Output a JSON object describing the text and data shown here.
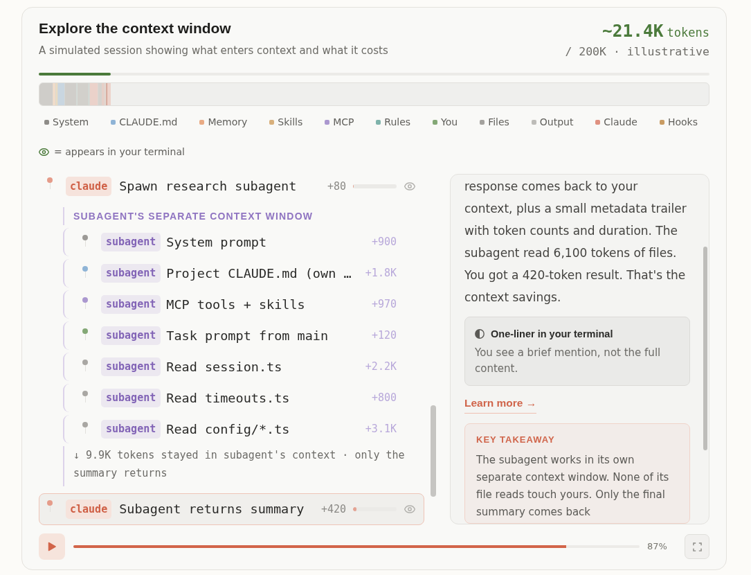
{
  "header": {
    "title": "Explore the context window",
    "subtitle": "A simulated session showing what enters context and what it costs",
    "token_total": "~21.4K",
    "token_unit": "tokens",
    "token_limit": "/ 200K · illustrative"
  },
  "context_meter": {
    "level": 0.107
  },
  "legend": [
    {
      "label": "System",
      "color": "#8e8c88"
    },
    {
      "label": "CLAUDE.md",
      "color": "#8fb4d6"
    },
    {
      "label": "Memory",
      "color": "#e9ab84"
    },
    {
      "label": "Skills",
      "color": "#d8b07c"
    },
    {
      "label": "MCP",
      "color": "#ab98cf"
    },
    {
      "label": "Rules",
      "color": "#7fb3ab"
    },
    {
      "label": "You",
      "color": "#84a876"
    },
    {
      "label": "Files",
      "color": "#a4a29e"
    },
    {
      "label": "Output",
      "color": "#bdbcb8"
    },
    {
      "label": "Claude",
      "color": "#df9180"
    },
    {
      "label": "Hooks",
      "color": "#c99c63"
    }
  ],
  "terminal_hint": "= appears in your terminal",
  "timeline": [
    {
      "kind": "main",
      "tag": "claude",
      "label": "Spawn research subagent",
      "tokens": "+80",
      "level": 0.02,
      "color": "#e59c8a",
      "in_terminal": true,
      "selected": false
    },
    {
      "kind": "group",
      "title": "SUBAGENT'S SEPARATE CONTEXT WINDOW",
      "children": [
        {
          "kind": "subagent",
          "tag": "subagent",
          "label": "System prompt",
          "tokens": "+900",
          "color": "#9c9a96"
        },
        {
          "kind": "subagent",
          "tag": "subagent",
          "label": "Project CLAUDE.md (own …",
          "tokens": "+1.8K",
          "color": "#8fb4d6"
        },
        {
          "kind": "subagent",
          "tag": "subagent",
          "label": "MCP tools + skills",
          "tokens": "+970",
          "color": "#ab98cf"
        },
        {
          "kind": "subagent",
          "tag": "subagent",
          "label": "Task prompt from main",
          "tokens": "+120",
          "color": "#84a876"
        },
        {
          "kind": "subagent",
          "tag": "subagent",
          "label": "Read session.ts",
          "tokens": "+2.2K",
          "color": "#a9a7a3"
        },
        {
          "kind": "subagent",
          "tag": "subagent",
          "label": "Read timeouts.ts",
          "tokens": "+800",
          "color": "#a9a7a3"
        },
        {
          "kind": "subagent",
          "tag": "subagent",
          "label": "Read config/*.ts",
          "tokens": "+3.1K",
          "color": "#a9a7a3"
        }
      ],
      "note": "↓ 9.9K tokens stayed in subagent's context · only the summary returns"
    },
    {
      "kind": "main",
      "tag": "claude",
      "label": "Subagent returns summary",
      "tokens": "+420",
      "level": 0.08,
      "color": "#e59c8a",
      "in_terminal": true,
      "selected": true
    }
  ],
  "detail_panel": {
    "body": "response comes back to your context, plus a small metadata trailer with token counts and duration. The subagent read 6,100 tokens of files. You got a 420-token result. That's the context savings.",
    "callout": {
      "title": "One-liner in your terminal",
      "text": "You see a brief mention, not the full content."
    },
    "link": "Learn more →",
    "takeaway": {
      "title": "KEY TAKEAWAY",
      "text": "The subagent works in its own separate context window. None of its file reads touch yours. Only the final summary comes back"
    }
  },
  "playback": {
    "level": 0.87,
    "percent": "87%"
  }
}
